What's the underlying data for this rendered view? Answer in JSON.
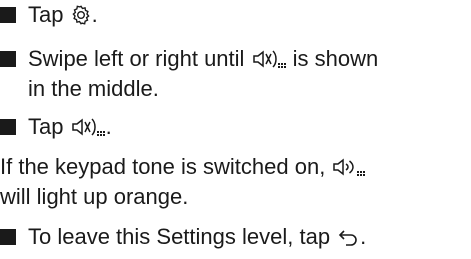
{
  "instructions": {
    "step1": {
      "before": "Tap ",
      "icon": "gear-icon",
      "after": "."
    },
    "step2": {
      "line1_before": "Swipe left or right until ",
      "icon": "keypad-tone-off-icon",
      "line1_after": " is shown",
      "line2": "in the middle."
    },
    "step3": {
      "before": "Tap ",
      "icon": "keypad-tone-off-icon",
      "after": "."
    },
    "note": {
      "line1_before": "If the keypad tone is switched on, ",
      "icon": "keypad-tone-on-icon",
      "line2": "will light up orange."
    },
    "step4": {
      "before": "To leave this Settings level, tap ",
      "icon": "back-arrow-icon",
      "after": "."
    }
  }
}
